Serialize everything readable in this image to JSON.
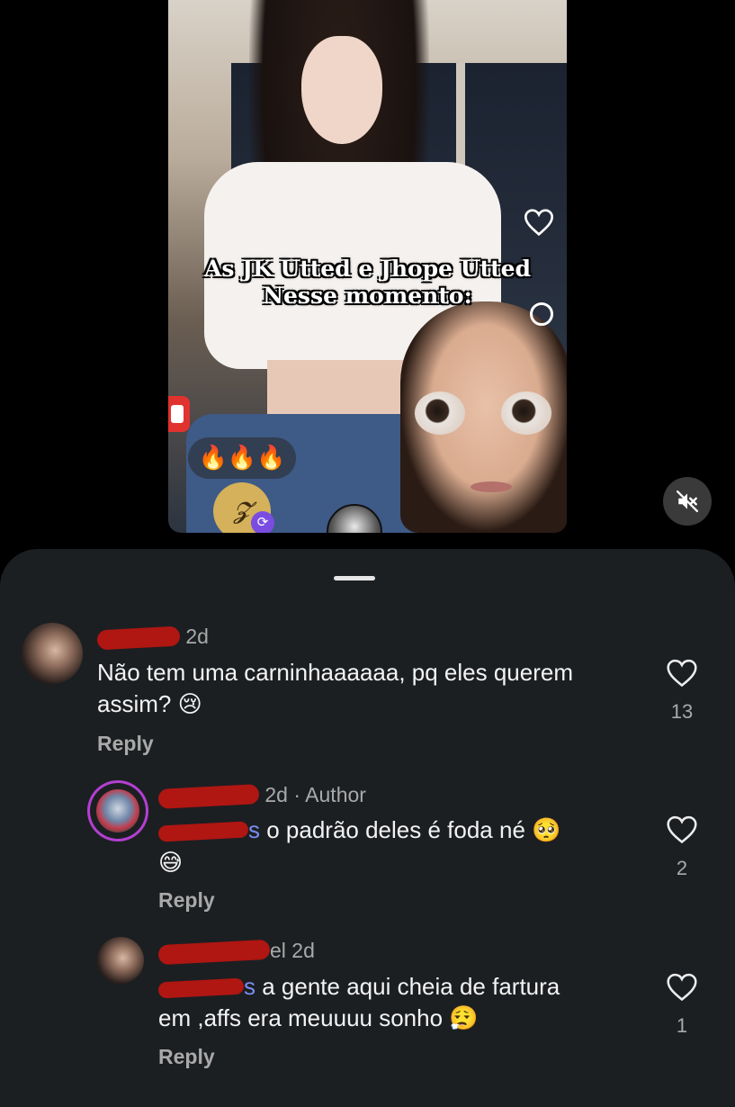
{
  "reel": {
    "caption_line1": "As JK Utted e Jhope Utted",
    "caption_line2": "Nesse momento:",
    "reactions": "🔥🔥🔥",
    "music_label": "𝓩",
    "mute_icon": "speaker-muted-icon"
  },
  "comments": [
    {
      "time": "2d",
      "text": "Não tem uma carninhaaaaaa, pq eles querem assim?",
      "emoji": "😢",
      "reply_label": "Reply",
      "likes": "13"
    },
    {
      "time": "2d",
      "author_tag": "Author",
      "mention_suffix": "s",
      "text": " o padrão deles é foda né",
      "emoji": "🥺",
      "emoji2": "😅",
      "reply_label": "Reply",
      "likes": "2"
    },
    {
      "time": "2d",
      "name_suffix": "el",
      "mention_suffix": "s",
      "text_line1": " a gente aqui cheia de fartura",
      "text_line2": "em ,affs era meuuuu sonho",
      "emoji": "😮‍💨",
      "reply_label": "Reply",
      "likes": "1"
    }
  ]
}
